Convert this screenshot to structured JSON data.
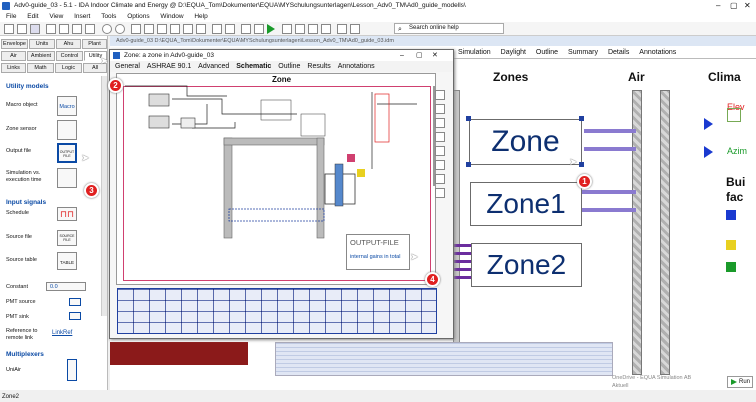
{
  "window": {
    "title": "Adv0-guide_03 - 5.1 - IDA Indoor Climate and Energy @ D:\\EQUA_Tom\\Dokumenter\\EQUA\\MYSchulungsunterlagen\\Lesson_Adv0_TM\\Ad0_guide_modells\\",
    "app_icon": "ida-ice-icon"
  },
  "menubar": [
    "File",
    "Edit",
    "View",
    "Insert",
    "Tools",
    "Options",
    "Window",
    "Help"
  ],
  "search": {
    "placeholder": "Search online help"
  },
  "palette": {
    "tabs_row1": [
      "Envelope",
      "Units",
      "Ahu",
      "Plant"
    ],
    "tabs_row2": [
      "Air",
      "Ambient",
      "Control",
      "Utility"
    ],
    "tabs_row3": [
      "Links",
      "Math",
      "Logic",
      "All"
    ],
    "sections": [
      "Utility models",
      "Input signals",
      "Multiplexers"
    ],
    "utility_items": [
      "Macro object",
      "Zone sensor",
      "Output file",
      "Simulation vs. execution time"
    ],
    "input_items": [
      "Schedule",
      "Source file",
      "Source table",
      "Constant",
      "PMT source",
      "PMT sink",
      "Reference to remote link"
    ],
    "mux_items": [
      "UniAir"
    ],
    "icon_texts": {
      "macro": "Macro",
      "output": "OUTPUT FILE",
      "source": "SOURCE FILE",
      "table": "TABLE",
      "constant": "0.0",
      "linkref": "LinkRef"
    }
  },
  "main": {
    "doc_path": "Adv0-guide_03 D:\\EQUA_Tom\\Dokumenter\\EQUA\\MYSchulungsunterlagen\\Lesson_Adv0_TM\\Ad0_guide_03.idm",
    "menu": [
      "Simulation",
      "Daylight",
      "Outline",
      "Summary",
      "Details",
      "Annotations"
    ],
    "column_headers": [
      "Zones",
      "Air",
      "Clima"
    ],
    "zones": [
      "Zone",
      "Zone1",
      "Zone2"
    ],
    "right_labels": [
      "Elev",
      "Azim",
      "Bui",
      "fac"
    ],
    "run_label": "Run",
    "notification": [
      "OneDrive - EQUA Simulation AB",
      "Aktuell"
    ]
  },
  "dialog": {
    "title": "Zone: a zone in Adv0-guide_03",
    "tabs": [
      "General",
      "ASHRAE 90.1",
      "Advanced",
      "Schematic",
      "Outline",
      "Results",
      "Annotations"
    ],
    "active_tab": "Schematic",
    "canvas_title": "Zone",
    "output_box": {
      "title": "OUTPUT-FILE",
      "subtitle": "internal gains in total"
    }
  },
  "badges": [
    "1",
    "2",
    "3",
    "4"
  ],
  "statusbar": {
    "text": "Zone2"
  },
  "colors": {
    "accent": "#0b4aa5",
    "badge": "#e02020",
    "zone_text": "#0d2f70",
    "wall_grey": "#a8a8a8",
    "pipe_purple": "#6b2d9e",
    "pink_frame": "#d04070",
    "floor_red": "#8b1a1a"
  }
}
